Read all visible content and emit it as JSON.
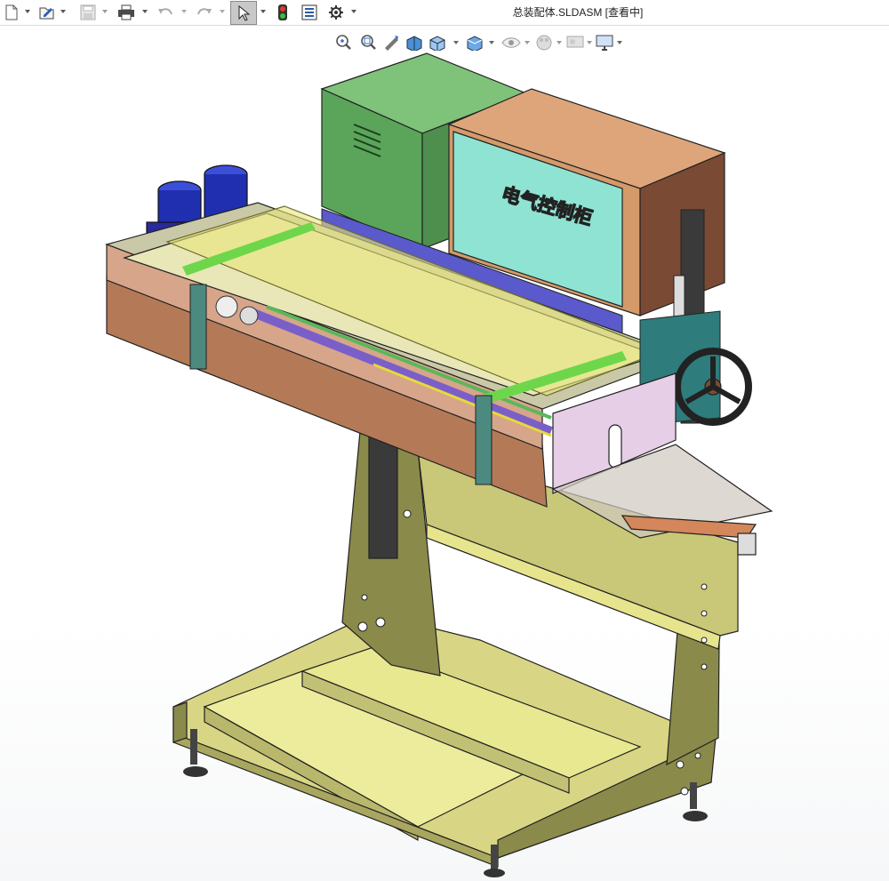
{
  "window": {
    "title": "总装配体.SLDASM [查看中]"
  },
  "toolbar": {
    "items": [
      {
        "name": "new-document",
        "icon": "new-document-icon"
      },
      {
        "name": "open",
        "icon": "open-folder-icon"
      },
      {
        "name": "save",
        "icon": "save-icon"
      },
      {
        "name": "print",
        "icon": "print-icon"
      },
      {
        "name": "undo",
        "icon": "undo-icon"
      },
      {
        "name": "redo",
        "icon": "redo-icon"
      },
      {
        "name": "select",
        "icon": "select-cursor-icon"
      },
      {
        "name": "rebuild",
        "icon": "traffic-light-icon"
      },
      {
        "name": "file-properties",
        "icon": "file-properties-icon"
      },
      {
        "name": "options",
        "icon": "gear-icon"
      }
    ]
  },
  "view_toolbar": {
    "items": [
      {
        "name": "zoom-to-fit",
        "icon": "zoom-fit-icon"
      },
      {
        "name": "zoom-to-area",
        "icon": "zoom-area-icon"
      },
      {
        "name": "previous-view",
        "icon": "previous-view-icon"
      },
      {
        "name": "section-view",
        "icon": "section-view-icon"
      },
      {
        "name": "view-orientation",
        "icon": "view-orientation-icon"
      },
      {
        "name": "display-style",
        "icon": "display-style-icon"
      },
      {
        "name": "hide-show-items",
        "icon": "eye-icon"
      },
      {
        "name": "edit-appearance",
        "icon": "appearance-icon"
      },
      {
        "name": "apply-scene",
        "icon": "scene-icon"
      },
      {
        "name": "view-settings",
        "icon": "monitor-icon"
      }
    ]
  },
  "model": {
    "cabinet_label": "电气控制柜",
    "colors": {
      "frame": "#8a8a4a",
      "base": "#e6e58e",
      "conveyor": "#b47a58",
      "cover": "#e8e67a",
      "green_box": "#5aa55a",
      "cabinet": "#d49a6a",
      "cabinet_panel": "#8fe3d3",
      "motor": "#1f2fb0",
      "handwheel": "#3a3a3a"
    }
  }
}
